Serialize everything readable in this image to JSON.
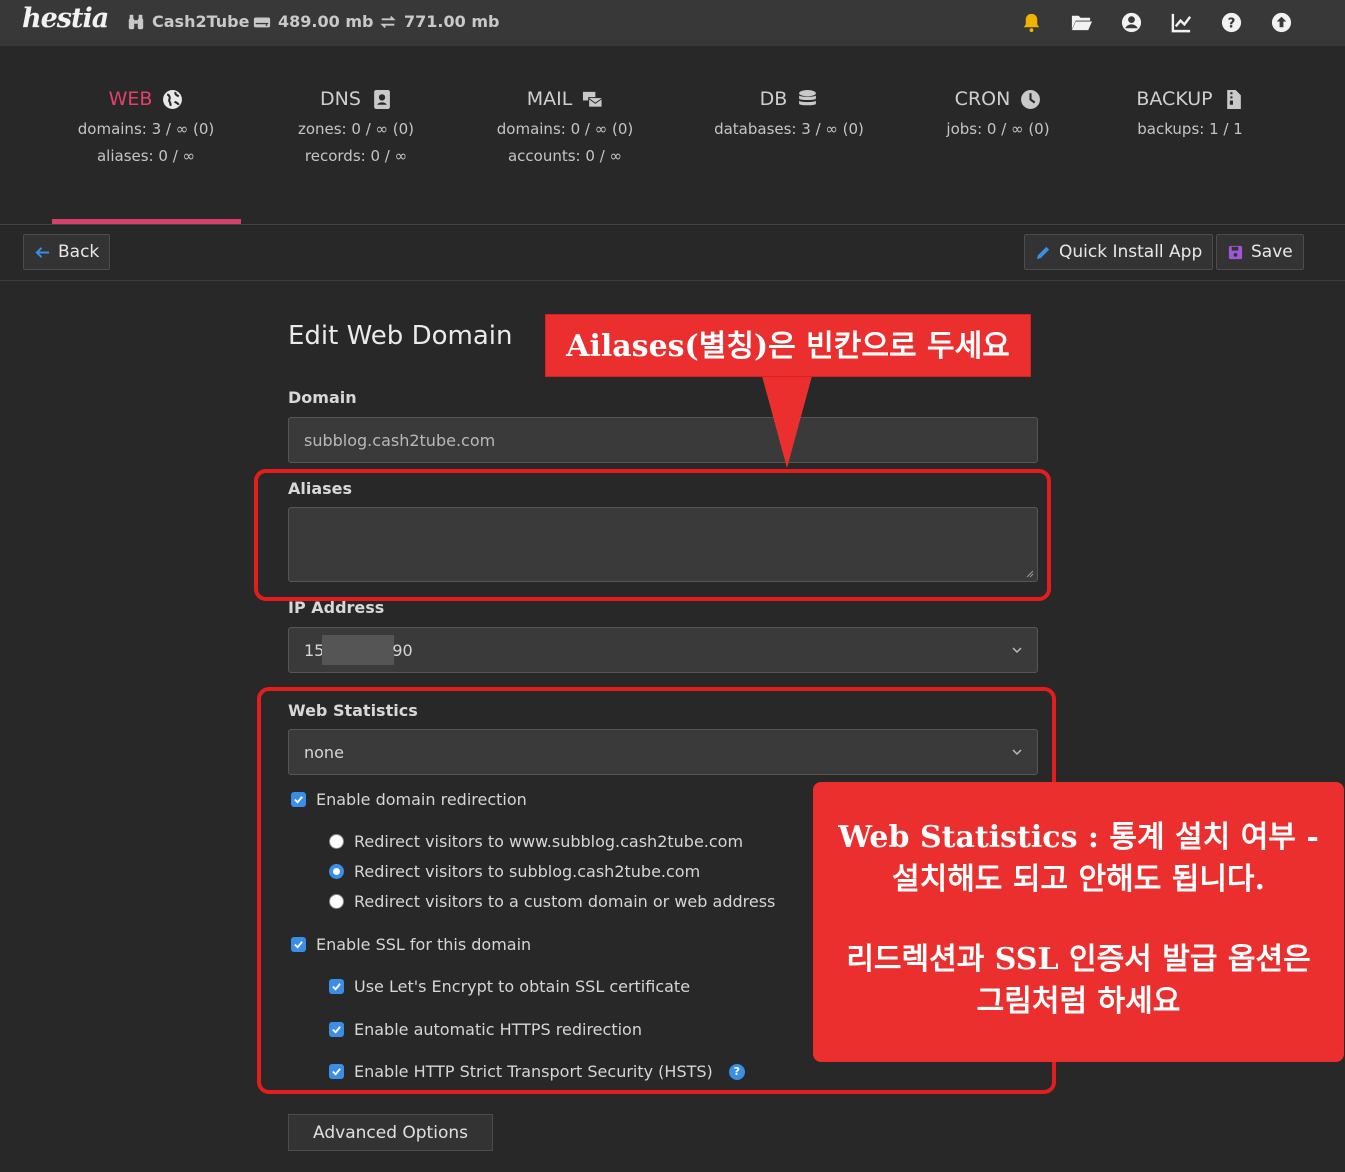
{
  "topbar": {
    "logo": "hestia",
    "user": "Cash2Tube",
    "disk": "489.00 mb",
    "bandwidth": "771.00 mb",
    "icons": [
      "bell-icon",
      "folder-icon",
      "user-circle-icon",
      "chart-line-icon",
      "question-circle-icon",
      "arrow-circle-up-icon"
    ],
    "accent_color": "#f0b400"
  },
  "tabs": [
    {
      "title": "WEB",
      "icon": "globe-icon",
      "lines": [
        "domains: 3 / ∞ (0)",
        "aliases: 0 / ∞"
      ],
      "active": true
    },
    {
      "title": "DNS",
      "icon": "address-book-icon",
      "lines": [
        "zones: 0 / ∞ (0)",
        "records: 0 / ∞"
      ]
    },
    {
      "title": "MAIL",
      "icon": "mail-bulk-icon",
      "lines": [
        "domains: 0 / ∞ (0)",
        "accounts: 0 / ∞"
      ]
    },
    {
      "title": "DB",
      "icon": "database-icon",
      "lines": [
        "databases: 3 / ∞ (0)"
      ]
    },
    {
      "title": "CRON",
      "icon": "clock-icon",
      "lines": [
        "jobs: 0 / ∞ (0)"
      ]
    },
    {
      "title": "BACKUP",
      "icon": "file-archive-icon",
      "lines": [
        "backups: 1 / 1"
      ]
    }
  ],
  "toolbar": {
    "back_label": "Back",
    "quick_install_label": "Quick Install App",
    "save_label": "Save"
  },
  "form": {
    "title": "Edit Web Domain",
    "domain_label": "Domain",
    "domain_value": "subblog.cash2tube.com",
    "aliases_label": "Aliases",
    "aliases_value": "",
    "ip_label": "IP Address",
    "ip_value_start": "15",
    "ip_value_end": "90",
    "stats_label": "Web Statistics",
    "stats_value": "none",
    "redirect_label": "Enable domain redirection",
    "redirect_options": [
      "Redirect visitors to www.subblog.cash2tube.com",
      "Redirect visitors to subblog.cash2tube.com",
      "Redirect visitors to a custom domain or web address"
    ],
    "redirect_selected": 1,
    "ssl_label": "Enable SSL for this domain",
    "letsencrypt_label": "Use Let's Encrypt to obtain SSL certificate",
    "https_redirect_label": "Enable automatic HTTPS redirection",
    "hsts_label": "Enable HTTP Strict Transport Security (HSTS)",
    "advanced_label": "Advanced Options"
  },
  "annotations": {
    "top_callout": "Ailases(별칭)은 빈칸으로 두세요",
    "right_callout_line1": "Web Statistics : 통계 설치 여부 -",
    "right_callout_line2": "설치해도 되고 안해도 됩니다.",
    "right_callout_line3": "리드렉션과 SSL 인증서 발급 옵션은",
    "right_callout_line4": "그림처럼 하세요",
    "color": "#eb2f2f"
  }
}
